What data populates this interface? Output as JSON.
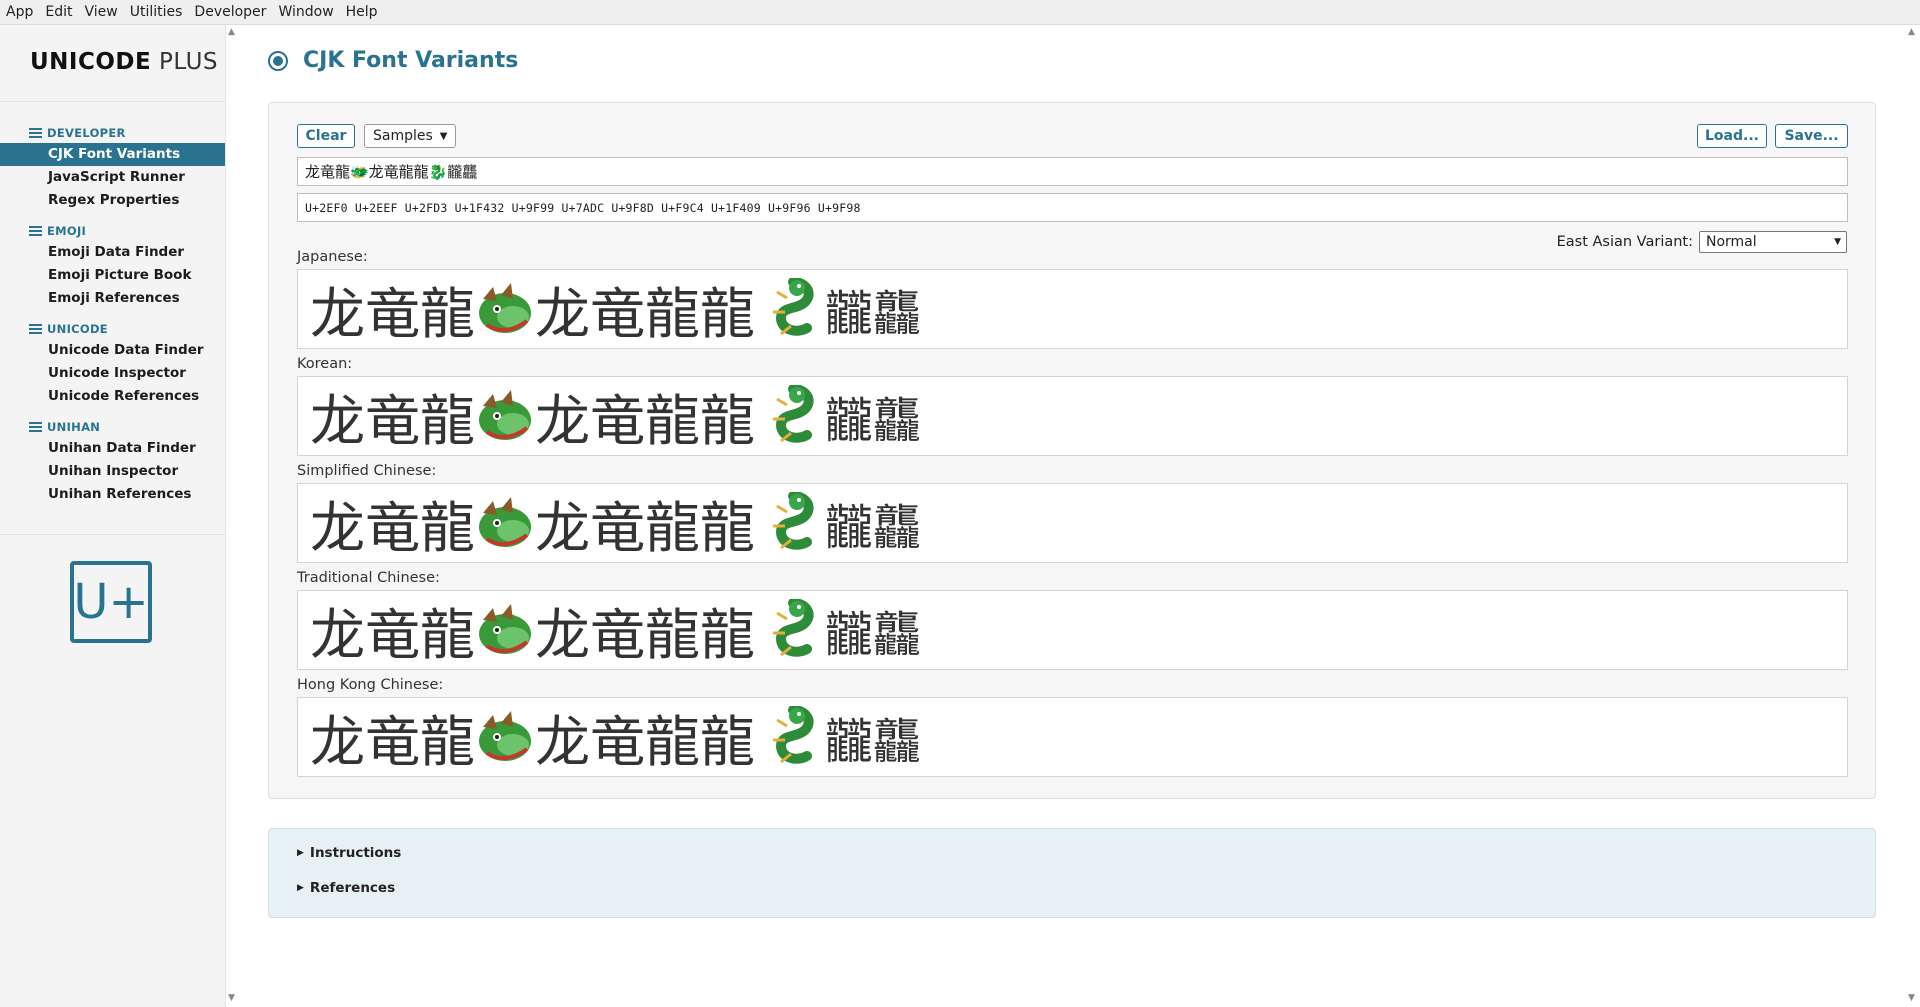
{
  "menubar": [
    "App",
    "Edit",
    "View",
    "Utilities",
    "Developer",
    "Window",
    "Help"
  ],
  "sidebar": {
    "brand_bold": "UNICODE",
    "brand_light": "PLUS",
    "categories": [
      {
        "label": "DEVELOPER",
        "items": [
          "CJK Font Variants",
          "JavaScript Runner",
          "Regex Properties"
        ]
      },
      {
        "label": "EMOJI",
        "items": [
          "Emoji Data Finder",
          "Emoji Picture Book",
          "Emoji References"
        ]
      },
      {
        "label": "UNICODE",
        "items": [
          "Unicode Data Finder",
          "Unicode Inspector",
          "Unicode References"
        ]
      },
      {
        "label": "UNIHAN",
        "items": [
          "Unihan Data Finder",
          "Unihan Inspector",
          "Unihan References"
        ]
      }
    ],
    "active_item": "CJK Font Variants",
    "logo_text": "U+"
  },
  "main": {
    "title": "CJK Font Variants",
    "toolbar": {
      "clear_label": "Clear",
      "samples_label": "Samples",
      "load_label": "Load...",
      "save_label": "Save..."
    },
    "text_input": "龙竜龍🐲龙竜龍龍🐉龖龘",
    "code_points": "U+2EF0 U+2EEF U+2FD3 U+1F432 U+9F99 U+7ADC U+9F8D U+F9C4 U+1F409 U+9F96 U+9F98",
    "east_asian_variant_label": "East Asian Variant:",
    "east_asian_variant_value": "Normal",
    "sample_glyphs_a": "龙竜龍",
    "sample_glyphs_b": "龙竜龍龍",
    "sample_glyphs_c": "龖龘",
    "languages": [
      "Japanese:",
      "Korean:",
      "Simplified Chinese:",
      "Traditional Chinese:",
      "Hong Kong Chinese:"
    ]
  },
  "disclosures": {
    "instructions": "Instructions",
    "references": "References"
  },
  "colors": {
    "accent": "#2a7390",
    "sidebar_bg": "#f4f4f4",
    "panel_bg": "#f6f6f6",
    "disclosure_bg": "#e7f0f3"
  }
}
